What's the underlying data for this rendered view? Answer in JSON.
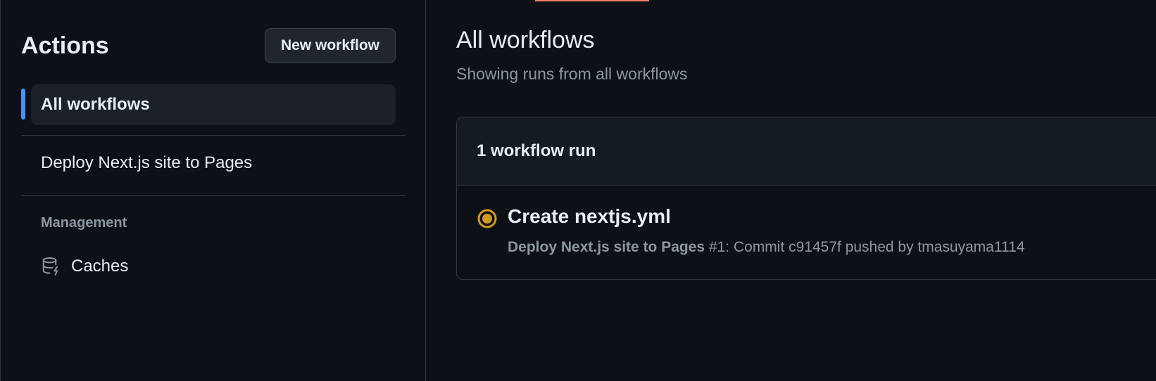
{
  "sidebar": {
    "title": "Actions",
    "new_workflow_label": "New workflow",
    "selected_item": "All workflows",
    "workflow_item": "Deploy Next.js site to Pages",
    "section_label": "Management",
    "caches_label": "Caches",
    "caches_icon": "database-icon"
  },
  "main": {
    "title": "All workflows",
    "subtitle": "Showing runs from all workflows",
    "runs_count_label": "1 workflow run",
    "runs": [
      {
        "status": "in-progress",
        "status_color": "#d29922",
        "title": "Create nextjs.yml",
        "workflow_name": "Deploy Next.js site to Pages",
        "meta_detail": " #1: Commit c91457f pushed by tmasuyama1114"
      }
    ]
  },
  "colors": {
    "accent": "#4493f8",
    "background": "#0d1117",
    "status_in_progress": "#d29922"
  }
}
